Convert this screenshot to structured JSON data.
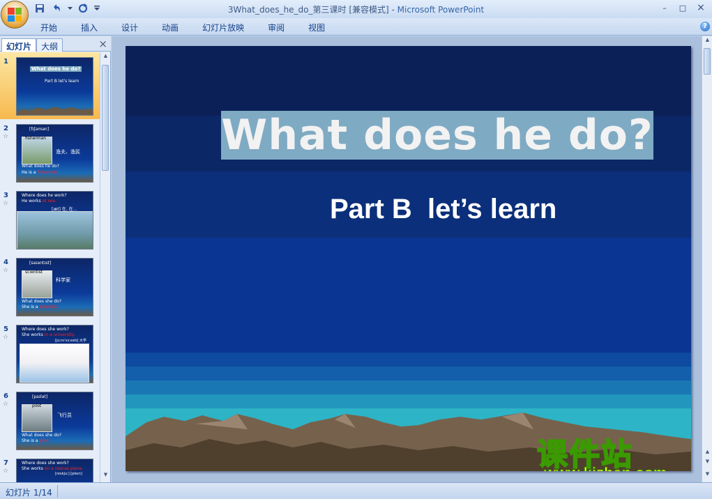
{
  "window": {
    "title_doc": "3What_does_he_do_第三课时 [兼容模式]",
    "title_sep": " - ",
    "title_app": "Microsoft PowerPoint",
    "minimize": "–",
    "maximize": "□",
    "close": "×"
  },
  "ribbon": {
    "tabs": [
      "开始",
      "插入",
      "设计",
      "动画",
      "幻灯片放映",
      "审阅",
      "视图"
    ],
    "help": "?"
  },
  "pane": {
    "tab_slides": "幻灯片",
    "tab_outline": "大纲",
    "close": "×",
    "thumbnails": [
      {
        "num": "1",
        "title": "What does he do?",
        "sub": "Part B  let's learn"
      },
      {
        "num": "2",
        "phon": "[fɪʃəmən]",
        "word": "fisherman",
        "cn": "渔夫、渔民",
        "q": "What does he do?",
        "a_pre": "He is a ",
        "a_red": "fisherman"
      },
      {
        "num": "3",
        "q": "Where does he work?",
        "a_pre": "He works ",
        "a_red": "at sea.",
        "extra": "[æt]  在, 在…"
      },
      {
        "num": "4",
        "phon": "[saɪəntɪst]",
        "word": "scientist",
        "cn": "科学家",
        "q": "What does she do?",
        "a_pre": "She is a ",
        "a_red": "scientist"
      },
      {
        "num": "5",
        "q": "Where does she work?",
        "a_pre": "She works ",
        "a_red": "in a university.",
        "extra": "[juːnɪˈvɜːsətɪ] 大学"
      },
      {
        "num": "6",
        "phon": "[paɪlət]",
        "word": "pilot",
        "cn": "飞行员",
        "q": "What does she do?",
        "a_pre": "She is a ",
        "a_red": "pilot"
      },
      {
        "num": "7",
        "q": "Where does she work?",
        "a_pre": "She works ",
        "a_red": "on a rescue plane.",
        "extra": "[reskjuː]  [pleɪn]"
      }
    ],
    "star": "☆"
  },
  "slide": {
    "title": "What does he do?",
    "subtitle": "Part B  let’s learn",
    "watermark_cn": "课件站",
    "watermark_url": "www.kjzhan.com"
  },
  "status": {
    "slide_count": "幻灯片 1/14"
  }
}
